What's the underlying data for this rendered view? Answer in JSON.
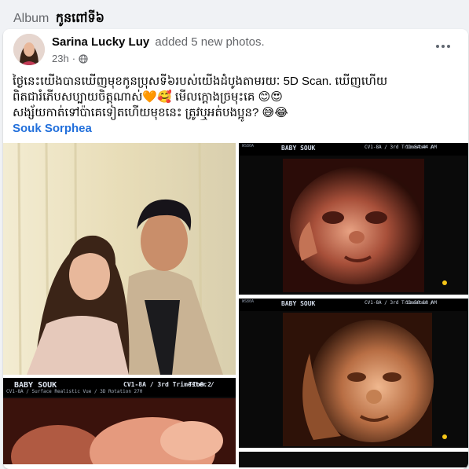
{
  "album": {
    "prefix": "Album",
    "name": "កូនពៅទី៦"
  },
  "post": {
    "author": "Sarina Lucky Luy",
    "action": "added 5 new photos.",
    "time": "23h",
    "audience_icon": "globe-icon",
    "caption_lines": [
      "ថ្ងៃនេះយើងបានឃើញមុខកូនប្រុសទី៦របស់យើងដំបូងតាមរយៈ 5D Scan. ឃើញហើយ",
      "ពិតជារំភើបសប្បាយចិត្តណាស់🧡🥰 មើលក្ដោងច្រមុះគេ 😊😍",
      "សង្ស័យកាត់ទៅប៉ាគេទៀតហើយមុខនេះ ត្រូវឬអត់បងប្អូន? 😅😂"
    ],
    "tagged": "Souk Sorphea"
  },
  "scans": {
    "top": {
      "brand": "WS80A",
      "patient": "BABY SOUK",
      "probe": "CV1-8A / 3rd Trimester /",
      "tib": "TIb0.2",
      "time": "11:54:44 AM"
    },
    "middle": {
      "brand": "WS80A",
      "patient": "BABY SOUK",
      "probe": "CV1-8A / 3rd Trimester /",
      "tib": "TIb0.2",
      "time": "11:50:18 AM"
    },
    "bottom": {
      "patient": "BABY SOUK",
      "probe": "CV1-8A / 3rd Trimester /",
      "tib": "TIb0.2",
      "mode": "CV1-8A / Surface Realistic Vue / 3D Rotation 270"
    }
  },
  "colors": {
    "link": "#216fdb",
    "secondary_text": "#65676b"
  }
}
